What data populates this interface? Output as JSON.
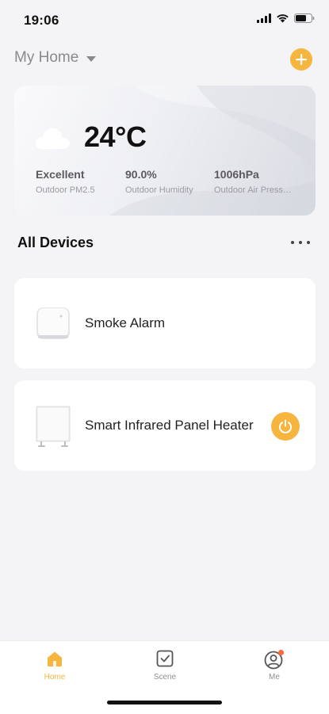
{
  "status_bar": {
    "time": "19:06",
    "icons": [
      "signal-icon",
      "wifi-icon",
      "battery-icon"
    ]
  },
  "header": {
    "home_name": "My Home",
    "add_icon": "plus-icon",
    "dropdown_icon": "caret-down-icon"
  },
  "weather": {
    "icon": "cloud-icon",
    "temperature": "24°C",
    "metrics": [
      {
        "value": "Excellent",
        "label": "Outdoor PM2.5"
      },
      {
        "value": "90.0%",
        "label": "Outdoor Humidity"
      },
      {
        "value": "1006hPa",
        "label": "Outdoor Air Pressure"
      }
    ]
  },
  "devices_section": {
    "title": "All Devices",
    "more_icon": "more-dots-icon"
  },
  "devices": [
    {
      "name": "Smoke Alarm",
      "icon": "smoke-alarm-image",
      "has_power": false
    },
    {
      "name": "Smart Infrared Panel Heater",
      "icon": "panel-heater-image",
      "has_power": true,
      "power_icon": "power-icon"
    }
  ],
  "tabs": [
    {
      "label": "Home",
      "icon": "home-icon",
      "active": true
    },
    {
      "label": "Scene",
      "icon": "scene-checkbox-icon",
      "active": false
    },
    {
      "label": "Me",
      "icon": "profile-icon",
      "active": false,
      "badge": true
    }
  ],
  "colors": {
    "accent": "#f5b53f",
    "badge": "#ff6a3d",
    "background": "#f4f3f5",
    "card": "#ffffff"
  }
}
